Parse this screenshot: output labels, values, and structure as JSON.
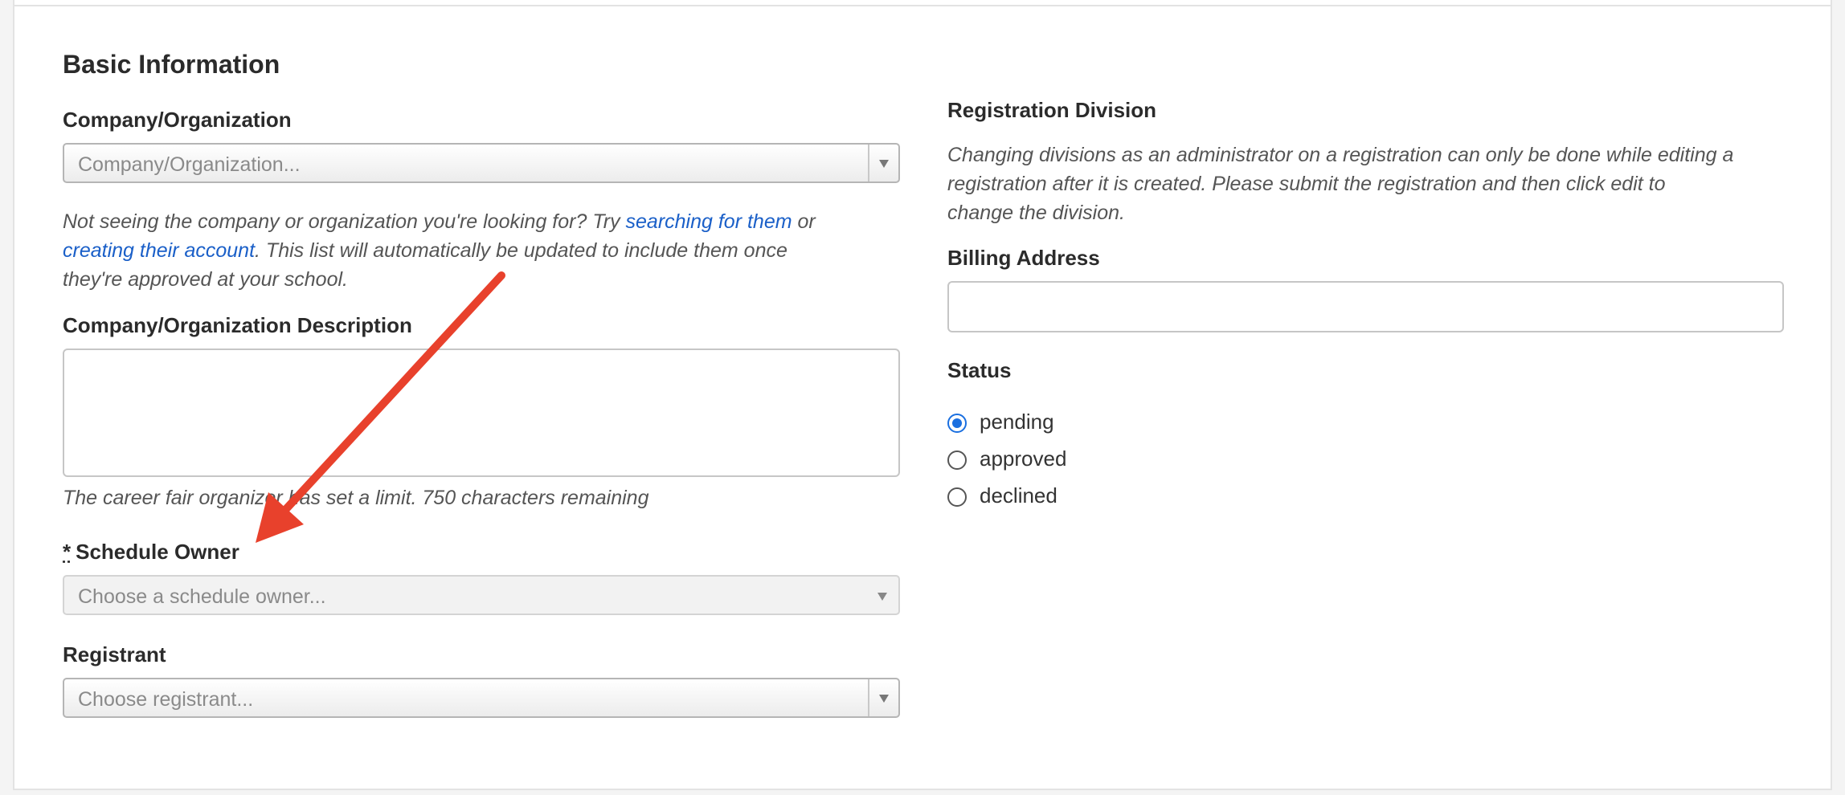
{
  "basic_information": {
    "title": "Basic Information",
    "company": {
      "label": "Company/Organization",
      "placeholder": "Company/Organization...",
      "help_prefix": "Not seeing the company or organization you're looking for? Try ",
      "help_link_1": "searching for them",
      "help_mid": " or",
      "help_link_2": "creating their account",
      "help_suffix": ". This list will automatically be updated to include them once",
      "help_line3": "they're approved at your school."
    },
    "description": {
      "label": "Company/Organization Description",
      "help": "The career fair organizer has set a limit. 750 characters remaining"
    },
    "schedule_owner": {
      "required_mark": "*",
      "label": "Schedule Owner",
      "placeholder": "Choose a schedule owner..."
    },
    "registrant": {
      "label": "Registrant",
      "placeholder": "Choose registrant..."
    }
  },
  "registration_division": {
    "label": "Registration Division",
    "help_line1": "Changing divisions as an administrator on a registration can only be done while editing a",
    "help_line2": "registration after it is created. Please submit the registration and then click edit to",
    "help_line3": "change the division."
  },
  "billing_address": {
    "label": "Billing Address",
    "value": ""
  },
  "status": {
    "label": "Status",
    "options": [
      {
        "label": "pending",
        "checked": true
      },
      {
        "label": "approved",
        "checked": false
      },
      {
        "label": "declined",
        "checked": false
      }
    ]
  },
  "colors": {
    "accent": "#1a6fe0",
    "link": "#1a5fc8",
    "annotation_arrow": "#e8412c"
  }
}
